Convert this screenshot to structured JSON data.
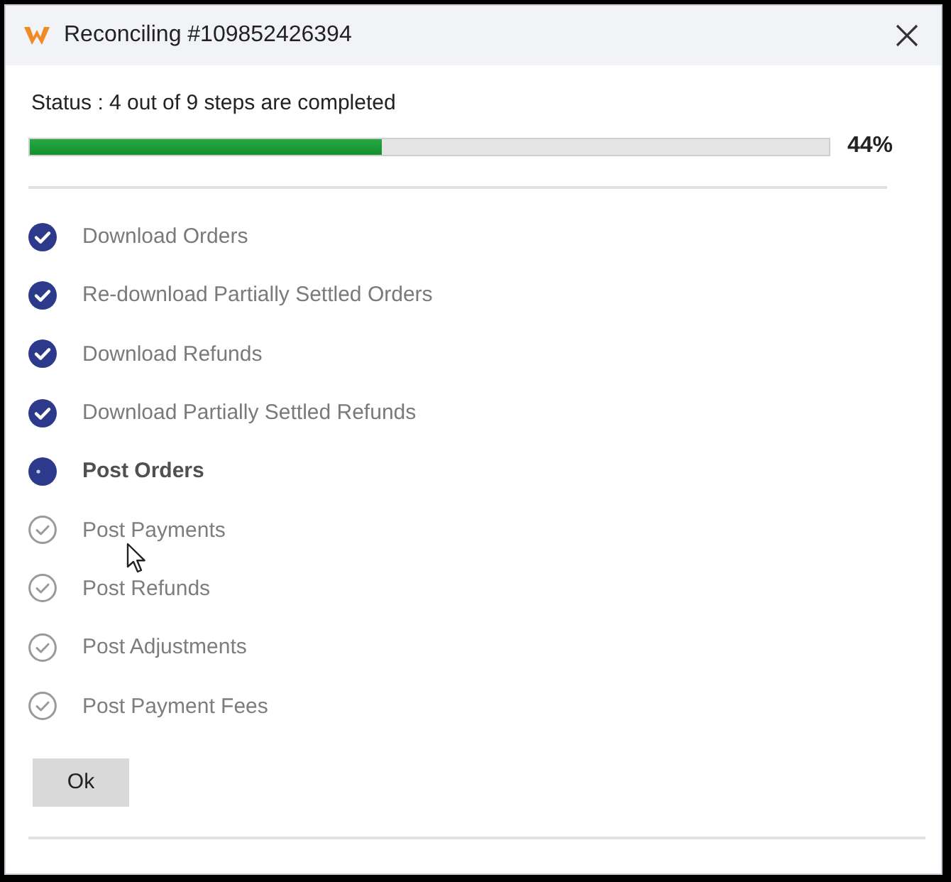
{
  "window": {
    "title": "Reconciling #109852426394"
  },
  "status": {
    "text": "Status : 4 out of 9 steps are completed",
    "progress": {
      "level": 0.44,
      "reading": "44%"
    }
  },
  "steps": [
    {
      "label": "Download Orders",
      "completed": true,
      "current": false
    },
    {
      "label": "Re-download Partially Settled Orders",
      "completed": true,
      "current": false
    },
    {
      "label": "Download Refunds",
      "completed": true,
      "current": false
    },
    {
      "label": "Download Partially Settled Refunds",
      "completed": true,
      "current": false
    },
    {
      "label": "Post Orders",
      "completed": false,
      "current": true
    },
    {
      "label": "Post Payments",
      "completed": false,
      "current": false
    },
    {
      "label": "Post Refunds",
      "completed": false,
      "current": false
    },
    {
      "label": "Post Adjustments",
      "completed": false,
      "current": false
    },
    {
      "label": "Post Payment Fees",
      "completed": false,
      "current": false
    }
  ],
  "buttons": [
    {
      "label": "Ok"
    }
  ]
}
